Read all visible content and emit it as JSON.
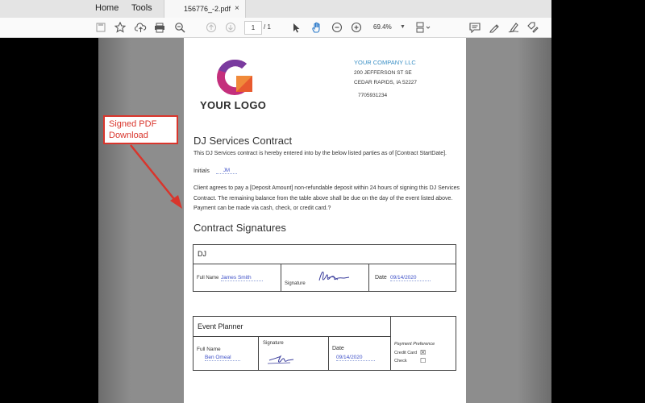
{
  "menu": {
    "home": "Home",
    "tools": "Tools"
  },
  "tab": {
    "title": "156776_-2.pdf",
    "close": "×"
  },
  "toolbar": {
    "page_current": "1",
    "page_total": "/ 1",
    "zoom": "69.4%",
    "icons": [
      "save-icon",
      "star-icon",
      "upload-icon",
      "print-icon",
      "zoom-out-search-icon",
      "page-up-icon",
      "page-down-icon",
      "select-pointer-icon",
      "hand-tool-icon",
      "zoom-minus-icon",
      "zoom-plus-icon",
      "page-display-icon",
      "comment-icon",
      "highlight-pen-icon",
      "sign-icon",
      "fill-sign-icon"
    ]
  },
  "document": {
    "logo_text": "YOUR LOGO",
    "company": "YOUR COMPANY LLC",
    "address_line1": "200 JEFFERSON ST SE",
    "address_line2": "CEDAR RAPIDS, IA 52227",
    "phone": "7705931234",
    "title": "DJ Services Contract",
    "intro": "This DJ Services contract is hereby entered into by the below listed parties as of [Contract StartDate].",
    "initials_label": "Initials",
    "initials_value": "JM",
    "paragraph": "Client agrees to pay a [Deposit Amount] non-refundable deposit within 24 hours of signing this DJ Services Contract. The remaining balance from the table above shall be due on the day of the event listed above. Payment can be made via cash, check, or credit card.?",
    "signatures_heading": "Contract Signatures",
    "dj_table": {
      "heading": "DJ",
      "full_name_label": "Full Name",
      "full_name_value": "James Smith",
      "signature_label": "Signature",
      "date_label": "Date",
      "date_value": "09/14/2020"
    },
    "planner_table": {
      "heading": "Event Planner",
      "full_name_label": "Full Name",
      "full_name_value": "Ben Omeal",
      "signature_label": "Signature",
      "date_label": "Date",
      "date_value": "09/14/2020",
      "payment_pref_label": "Payment Preference",
      "credit_card_label": "Credit Card",
      "credit_card_checked": "☒",
      "check_label": "Check",
      "check_checked": "☐"
    }
  },
  "annotation": {
    "line1": "Signed PDF",
    "line2": "Download",
    "color": "#d9352c"
  }
}
